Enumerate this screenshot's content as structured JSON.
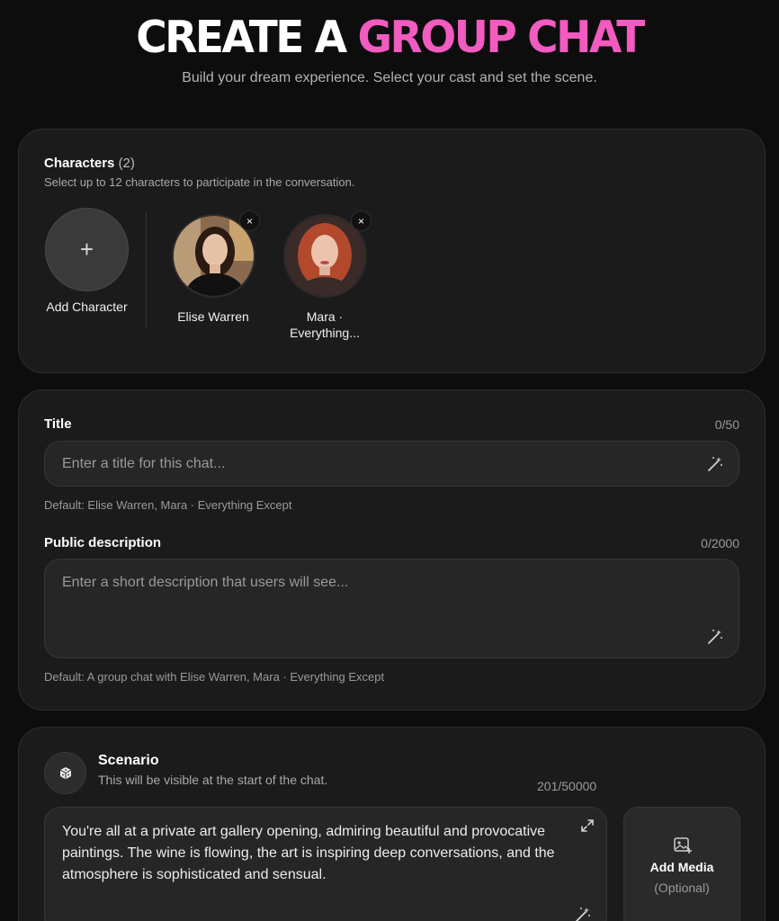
{
  "header": {
    "title_white": "CREATE A",
    "title_pink": "GROUP CHAT",
    "subtitle": "Build your dream experience. Select your cast and set the scene."
  },
  "characters": {
    "label": "Characters",
    "count": "(2)",
    "description": "Select up to 12 characters to participate in the conversation.",
    "add_label": "Add Character",
    "add_icon": "+",
    "items": [
      {
        "name": "Elise Warren"
      },
      {
        "name_line1": "Mara ·",
        "name_line2": "Everything..."
      }
    ],
    "remove_icon": "×"
  },
  "title_field": {
    "label": "Title",
    "counter": "0/50",
    "placeholder": "Enter a title for this chat...",
    "hint": "Default: Elise Warren, Mara · Everything Except"
  },
  "description_field": {
    "label": "Public description",
    "counter": "0/2000",
    "placeholder": "Enter a short description that users will see...",
    "hint": "Default: A group chat with Elise Warren, Mara · Everything Except"
  },
  "scenario": {
    "label": "Scenario",
    "description": "This will be visible at the start of the chat.",
    "counter": "201/50000",
    "text": "You're all at a private art gallery opening, admiring beautiful and provocative paintings. The wine is flowing, the art is inspiring deep conversations, and the atmosphere is sophisticated and sensual.",
    "media_label": "Add Media",
    "media_sub": "(Optional)"
  },
  "colors": {
    "accent_pink": "#f25bc0",
    "background": "#0d0d0d",
    "card": "#1b1b1b"
  },
  "icons": [
    "plus-icon",
    "close-icon",
    "magic-wand-icon",
    "dice-icon",
    "expand-icon",
    "image-add-icon"
  ]
}
